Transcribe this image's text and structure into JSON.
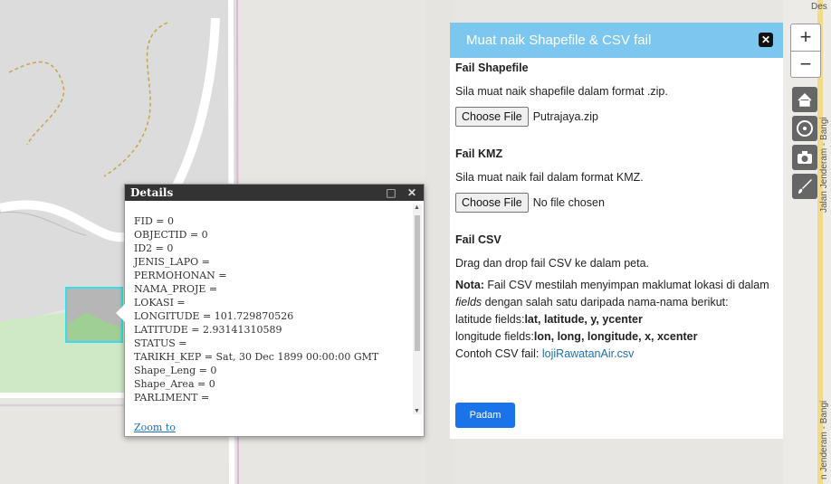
{
  "popup": {
    "title": "Details",
    "controls": "□ ✕",
    "fields": [
      "FID = 0",
      "OBJECTID = 0",
      "ID2 = 0",
      "JENIS_LAPO =",
      "PERMOHONAN =",
      "NAMA_PROJE =",
      "LOKASI =",
      "LONGITUDE = 101.729870526",
      "LATITUDE = 2.93141310589",
      "STATUS =",
      "TARIKH_KEP = Sat, 30 Dec 1899 00:00:00 GMT",
      "Shape_Leng = 0",
      "Shape_Area = 0",
      "PARLIMENT ="
    ],
    "zoom_link": "Zoom to"
  },
  "panel": {
    "title": "Muat naik Shapefile & CSV fail",
    "close_icon": "close-icon",
    "shapefile": {
      "heading": "Fail Shapefile",
      "desc": "Sila muat naik shapefile dalam format .zip.",
      "button": "Choose File",
      "file": "Putrajaya.zip"
    },
    "kmz": {
      "heading": "Fail KMZ",
      "desc": "Sila muat naik fail dalam format KMZ.",
      "button": "Choose File",
      "file": "No file chosen"
    },
    "csv": {
      "heading": "Fail CSV",
      "desc": "Drag dan drop fail CSV ke dalam peta.",
      "note_label": "Nota:",
      "note_text1": " Fail CSV mestilah menyimpan maklumat lokasi di dalam ",
      "note_fields": "fields",
      "note_text2": " dengan salah satu daripada nama-nama berikut:",
      "lat_label": "latitude fields:",
      "lat_values": "lat, latitude, y, ycenter",
      "lon_label": "longitude fields:",
      "lon_values": "lon, long, longitude, x, xcenter",
      "example_label": "Contoh CSV fail: ",
      "example_link": "lojiRawatanAir.csv"
    },
    "delete_button": "Padam"
  },
  "map": {
    "zoom_in": "+",
    "zoom_out": "−",
    "road_label_1": "Jalan Jenderam - Bangi",
    "road_label_2": "n Jenderam - Bangi",
    "top_right_label": "Des"
  },
  "colors": {
    "panel_header": "#7cc7f0",
    "button_blue": "#1a73e8",
    "polygon_outline": "#33e0e8"
  }
}
